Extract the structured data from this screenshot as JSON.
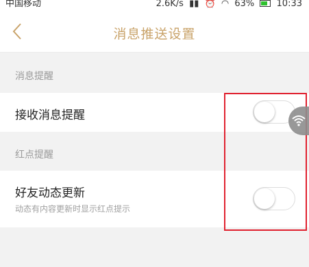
{
  "status_bar": {
    "carrier": "中国移动",
    "speed": "2.6K/s",
    "battery": "63%",
    "time": "10:33"
  },
  "header": {
    "title": "消息推送设置"
  },
  "sections": [
    {
      "title": "消息提醒",
      "items": [
        {
          "label": "接收消息提醒",
          "toggle_on": false
        }
      ]
    },
    {
      "title": "红点提醒",
      "items": [
        {
          "label": "好友动态更新",
          "subtitle": "动态有内容更新时显示红点提示",
          "toggle_on": false
        }
      ]
    }
  ],
  "colors": {
    "accent": "#c9a36a",
    "highlight": "#e01f2d",
    "background": "#f2f2f2"
  }
}
